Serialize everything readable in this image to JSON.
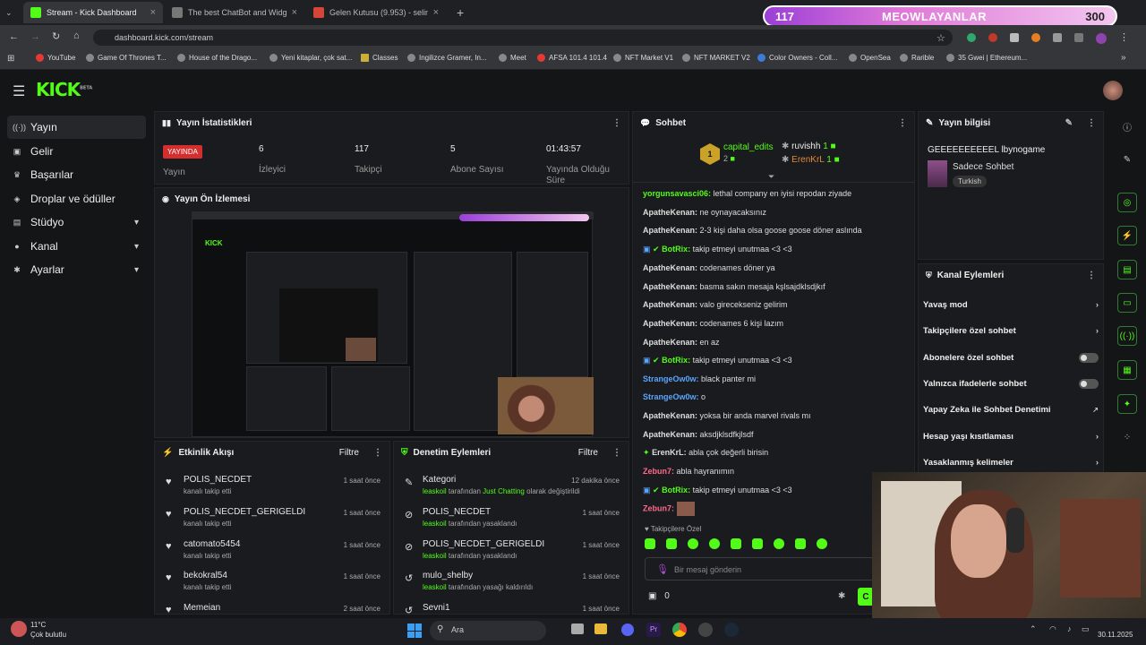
{
  "browser": {
    "tabs": [
      {
        "title": "Stream - Kick Dashboard",
        "active": true
      },
      {
        "title": "The best ChatBot and Widgets",
        "active": false
      },
      {
        "title": "Gelen Kutusu (9.953) - selintek",
        "active": false
      }
    ],
    "url": "dashboard.kick.com/stream",
    "bookmarks": [
      "YouTube",
      "Game Of Thrones T...",
      "House of the Drago...",
      "Yeni kitaplar, çok sat...",
      "Classes",
      "Ingilizce Gramer, In...",
      "Meet",
      "AFSA 101.4 101.4",
      "NFT Market V1",
      "NFT MARKET V2",
      "Color Owners - Coll...",
      "OpenSea",
      "Rarible",
      "35 Gwei | Ethereum..."
    ]
  },
  "overlay": {
    "left_count": "117",
    "title": "MEOWLAYANLAR",
    "right_count": "300"
  },
  "brand": {
    "logo": "KICK",
    "beta": "BETA"
  },
  "sidebar": {
    "items": [
      {
        "label": "Yayın",
        "icon": "stream-icon",
        "selected": true
      },
      {
        "label": "Gelir",
        "icon": "wallet-icon"
      },
      {
        "label": "Başarılar",
        "icon": "trophy-icon"
      },
      {
        "label": "Droplar ve ödüller",
        "icon": "gift-icon"
      },
      {
        "label": "Stüdyo",
        "icon": "studio-icon",
        "expandable": true
      },
      {
        "label": "Kanal",
        "icon": "person-icon",
        "expandable": true
      },
      {
        "label": "Ayarlar",
        "icon": "gear-icon",
        "expandable": true
      }
    ]
  },
  "stats": {
    "title": "Yayın İstatistikleri",
    "live_badge": "YAYINDA",
    "live_label": "Yayın",
    "viewers": "6",
    "viewers_label": "İzleyici",
    "followers": "117",
    "followers_label": "Takipçi",
    "subs": "5",
    "subs_label": "Abone Sayısı",
    "uptime": "01:43:57",
    "uptime_label": "Yayında Olduğu Süre"
  },
  "preview": {
    "title": "Yayın Ön İzlemesi"
  },
  "activity": {
    "title": "Etkinlik Akışı",
    "filter": "Filtre",
    "items": [
      {
        "name": "POLIS_NECDET",
        "desc": "kanalı takip etti",
        "time": "1 saat önce"
      },
      {
        "name": "POLIS_NECDET_GERIGELDI",
        "desc": "kanalı takip etti",
        "time": "1 saat önce"
      },
      {
        "name": "catomato5454",
        "desc": "kanalı takip etti",
        "time": "1 saat önce"
      },
      {
        "name": "bekokral54",
        "desc": "kanalı takip etti",
        "time": "1 saat önce"
      },
      {
        "name": "Memeian",
        "desc": "",
        "time": "2 saat önce"
      }
    ]
  },
  "moderation": {
    "title": "Denetim Eylemleri",
    "filter": "Filtre",
    "items": [
      {
        "name": "Kategori",
        "actor": "leaskoil",
        "desc_pre": " tarafından ",
        "highlight": "Just Chatting",
        "desc_post": " olarak değiştirildi",
        "time": "12 dakika önce"
      },
      {
        "name": "POLIS_NECDET",
        "actor": "leaskoil",
        "desc_pre": " tarafından yasaklandı",
        "highlight": "",
        "desc_post": "",
        "time": "1 saat önce"
      },
      {
        "name": "POLIS_NECDET_GERIGELDI",
        "actor": "leaskoil",
        "desc_pre": " tarafından yasaklandı",
        "highlight": "",
        "desc_post": "",
        "time": "1 saat önce"
      },
      {
        "name": "mulo_shelby",
        "actor": "leaskoil",
        "desc_pre": " tarafından yasağı kaldırıldı",
        "highlight": "",
        "desc_post": "",
        "time": "1 saat önce"
      },
      {
        "name": "Sevni1",
        "actor": "",
        "desc_pre": "",
        "highlight": "",
        "desc_post": "",
        "time": "1 saat önce"
      }
    ]
  },
  "chat": {
    "title": "Sohbet",
    "top": [
      {
        "name": "capital_edits",
        "count": "2"
      },
      {
        "name": "ruvishh",
        "count": "1"
      },
      {
        "name": "ErenKrL",
        "count": "1"
      }
    ],
    "top_rank": "1",
    "messages": [
      {
        "user": "yorgunsavasci06:",
        "text": " lethal company en iyisi repodan ziyade",
        "color": "w"
      },
      {
        "user": "ApatheKenan:",
        "text": " ne oynayacaksınız",
        "color": "w"
      },
      {
        "user": "ApatheKenan:",
        "text": " 2-3 kişi daha olsa goose goose döner aslında",
        "color": "w"
      },
      {
        "user": "BotRix:",
        "text": " takip etmeyi unutmaa <3 <3",
        "color": "g"
      },
      {
        "user": "ApatheKenan:",
        "text": " codenames döner ya",
        "color": "w"
      },
      {
        "user": "ApatheKenan:",
        "text": " basma sakın mesaja kşlsajdklsdjkıf",
        "color": "w"
      },
      {
        "user": "ApatheKenan:",
        "text": " valo girecekseniz gelirim",
        "color": "w"
      },
      {
        "user": "ApatheKenan:",
        "text": " codenames 6 kişi lazım",
        "color": "w"
      },
      {
        "user": "ApatheKenan:",
        "text": " en az",
        "color": "w"
      },
      {
        "user": "BotRix:",
        "text": " takip etmeyi unutmaa <3 <3",
        "color": "g"
      },
      {
        "user": "StrangeOw0w:",
        "text": " black panter mi",
        "color": "b"
      },
      {
        "user": "StrangeOw0w:",
        "text": " o",
        "color": "b"
      },
      {
        "user": "ApatheKenan:",
        "text": " yoksa bir anda marvel rivals mı",
        "color": "w"
      },
      {
        "user": "ApatheKenan:",
        "text": " aksdjklsdfkjlsdf",
        "color": "w"
      },
      {
        "user": "ErenKrL:",
        "text": " abla çok değerli birisin",
        "color": "w"
      },
      {
        "user": "Zebun7:",
        "text": " abla hayranımın",
        "color": "p"
      },
      {
        "user": "BotRix:",
        "text": " takip etmeyi unutmaa <3 <3",
        "color": "g"
      },
      {
        "user": "Zebun7:",
        "text": "",
        "color": "p"
      }
    ],
    "followers_only_label": "Takipçilere Özel",
    "input_placeholder": "Bir mesaj gönderin",
    "count": "0",
    "send": "C"
  },
  "info": {
    "title": "Yayın bilgisi",
    "stream_title": "GEEEEEEEEEEL lbynogame",
    "category": "Sadece Sohbet",
    "tag": "Turkish"
  },
  "channel_actions": {
    "title": "Kanal Eylemleri",
    "items": [
      {
        "label": "Yavaş mod",
        "type": "arrow"
      },
      {
        "label": "Takipçilere özel sohbet",
        "type": "arrow"
      },
      {
        "label": "Abonelere özel sohbet",
        "type": "toggle"
      },
      {
        "label": "Yalnızca ifadelerle sohbet",
        "type": "toggle"
      },
      {
        "label": "Yapay Zeka ile Sohbet Denetimi",
        "type": "ext"
      },
      {
        "label": "Hesap yaşı kısıtlaması",
        "type": "arrow"
      },
      {
        "label": "Yasaklanmış kelimeler",
        "type": "arrow"
      }
    ]
  },
  "taskbar": {
    "weather_temp": "11°C",
    "weather_text": "Çok bulutlu",
    "search": "Ara",
    "date": "30.11.2025"
  }
}
